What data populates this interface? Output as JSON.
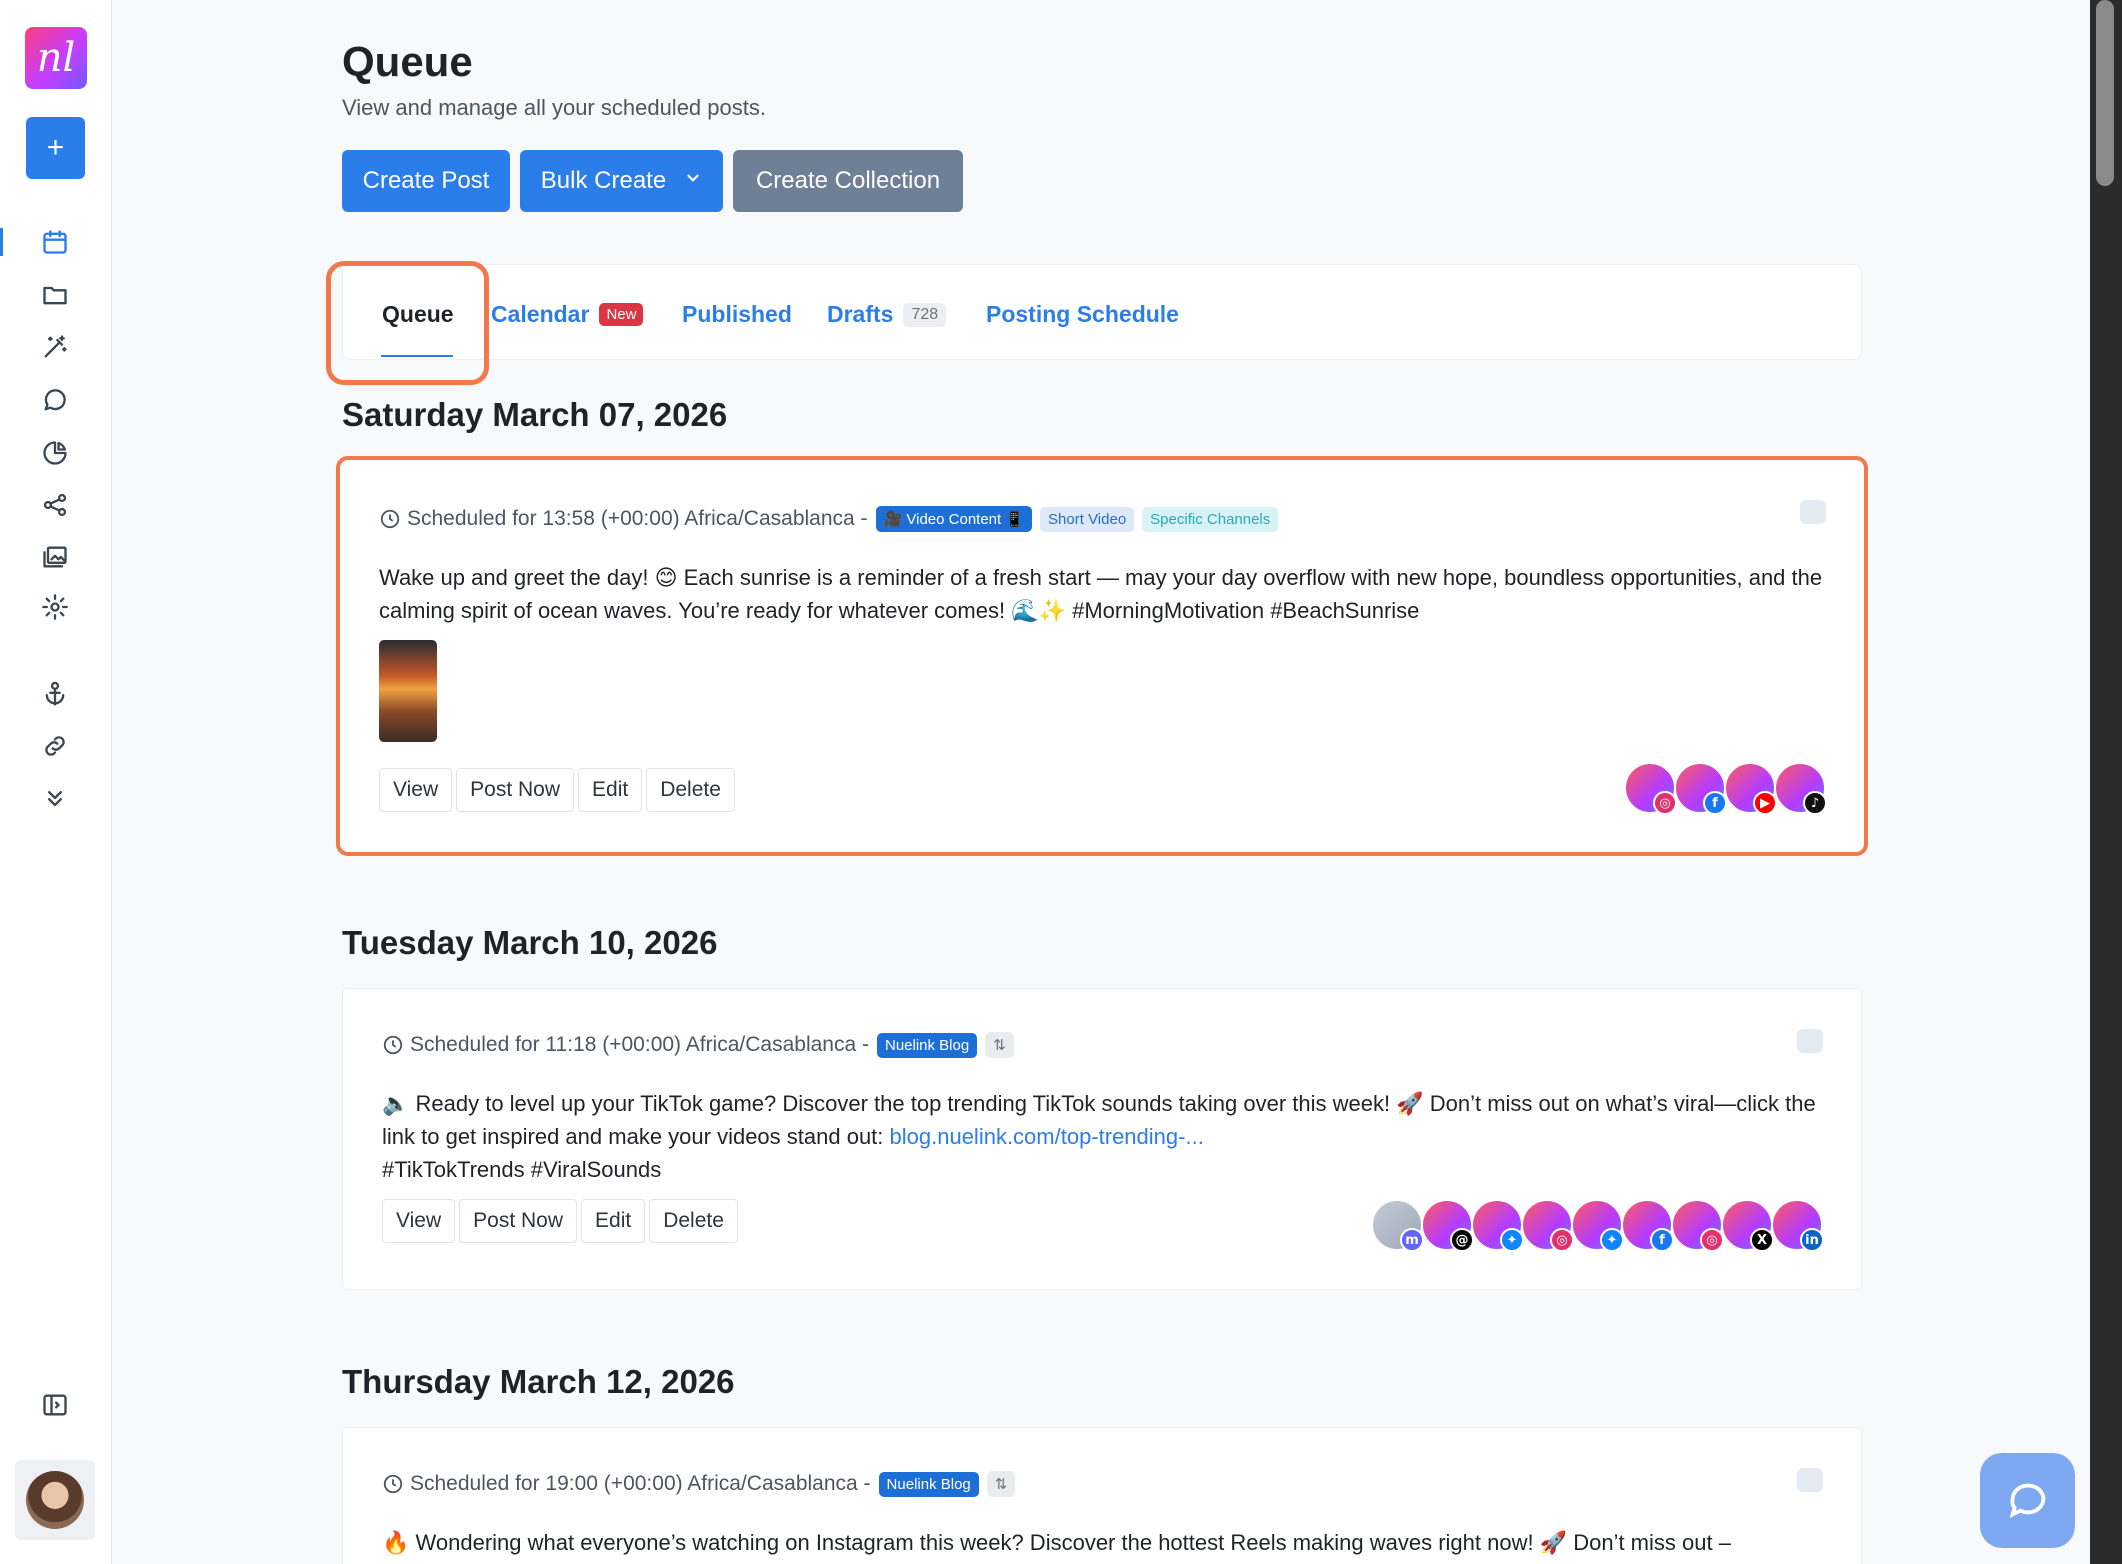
{
  "app": {
    "logo_text": "nl",
    "add_label": "+"
  },
  "sidebar": {
    "icons": [
      "calendar-icon",
      "folder-icon",
      "magic-wand-icon",
      "chat-icon",
      "pie-chart-icon",
      "share-icon",
      "gallery-icon",
      "settings-icon",
      "anchor-icon",
      "link-icon",
      "chevrons-down-icon",
      "collapse-sidebar-icon"
    ]
  },
  "header": {
    "title": "Queue",
    "subtitle": "View and manage all your scheduled posts."
  },
  "toolbar": {
    "create_post": "Create Post",
    "bulk_create": "Bulk Create",
    "bulk_chevron": "⌄",
    "create_collection": "Create Collection"
  },
  "tabs": {
    "queue": "Queue",
    "calendar": "Calendar",
    "calendar_badge": "New",
    "published": "Published",
    "drafts": "Drafts",
    "drafts_count": "728",
    "posting_schedule": "Posting Schedule"
  },
  "actions": {
    "view": "View",
    "post_now": "Post Now",
    "edit": "Edit",
    "delete": "Delete"
  },
  "days": [
    {
      "date": "Saturday March 07, 2026",
      "post": {
        "scheduled": "Scheduled for 13:58 (+00:00) Africa/Casablanca -",
        "tags": [
          "🎥 Video Content 📱",
          "Short Video",
          "Specific Channels"
        ],
        "text": "Wake up and greet the day! 😊 Each sunrise is a reminder of a fresh start — may your day overflow with new hope, boundless opportunities, and the calming spirit of ocean waves. You’re ready for whatever comes! 🌊✨ #MorningMotivation #BeachSunrise",
        "channels": [
          "instagram",
          "facebook",
          "youtube",
          "tiktok"
        ]
      }
    },
    {
      "date": "Tuesday March 10, 2026",
      "post": {
        "scheduled": "Scheduled for 11:18 (+00:00) Africa/Casablanca -",
        "tags": [
          "Nuelink Blog",
          "⇅"
        ],
        "text_before": "🔈 Ready to level up your TikTok game? Discover the top trending TikTok sounds taking over this week! 🚀 Don’t miss out on what’s viral—click the link to get inspired and make your videos stand out: ",
        "link": "blog.nuelink.com/top-trending-...",
        "text_after": "#TikTokTrends #ViralSounds",
        "channels": [
          "mastodon",
          "threads",
          "bluesky",
          "instagram",
          "bluesky",
          "facebook",
          "instagram",
          "x",
          "linkedin"
        ]
      }
    },
    {
      "date": "Thursday March 12, 2026",
      "post": {
        "scheduled": "Scheduled for 19:00 (+00:00) Africa/Casablanca -",
        "tags": [
          "Nuelink Blog",
          "⇅"
        ],
        "text": "🔥 Wondering what everyone’s watching on Instagram this week? Discover the hottest Reels making waves right now! 🚀 Don’t miss out –"
      }
    }
  ],
  "colors": {
    "accent": "#2b7de9",
    "highlight": "#f2774b",
    "secondary": "#6e7f96"
  }
}
